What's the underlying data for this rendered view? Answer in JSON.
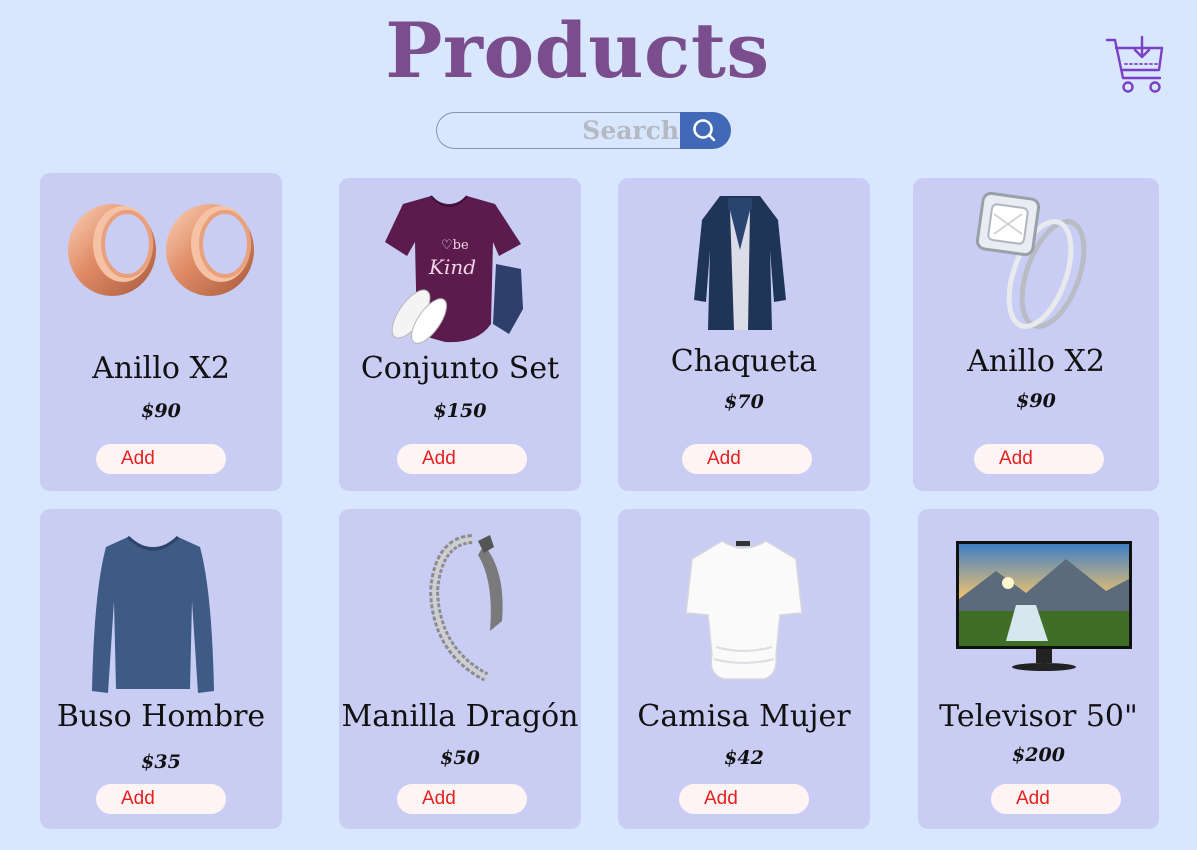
{
  "header": {
    "title": "Products",
    "search_placeholder": "Search",
    "search_icon": "magnifier-icon",
    "cart_icon": "cart-download-icon"
  },
  "colors": {
    "background": "#d9e7fe",
    "card": "#c9cdf3",
    "title": "#7a4e8c",
    "search_button": "#4169b8",
    "add_text": "#e52020",
    "add_bg": "#fff4f4",
    "cart_icon": "#7b3fc4"
  },
  "products": [
    {
      "name": "Anillo X2",
      "price": "$90",
      "add_label": "Add",
      "image": "rose-gold-ear-tunnels"
    },
    {
      "name": "Conjunto Set",
      "price": "$150",
      "add_label": "Add",
      "image": "purple-tshirt-outfit"
    },
    {
      "name": "Chaqueta",
      "price": "$70",
      "add_label": "Add",
      "image": "navy-coat"
    },
    {
      "name": "Anillo X2",
      "price": "$90",
      "add_label": "Add",
      "image": "diamond-ring-set"
    },
    {
      "name": "Buso Hombre",
      "price": "$35",
      "add_label": "Add",
      "image": "blue-long-sleeve-shirt"
    },
    {
      "name": "Manilla Dragón",
      "price": "$50",
      "add_label": "Add",
      "image": "dragon-bracelet"
    },
    {
      "name": "Camisa Mujer",
      "price": "$42",
      "add_label": "Add",
      "image": "white-womens-top"
    },
    {
      "name": "Televisor 50\"",
      "price": "$200",
      "add_label": "Add",
      "image": "tv-landscape"
    }
  ]
}
